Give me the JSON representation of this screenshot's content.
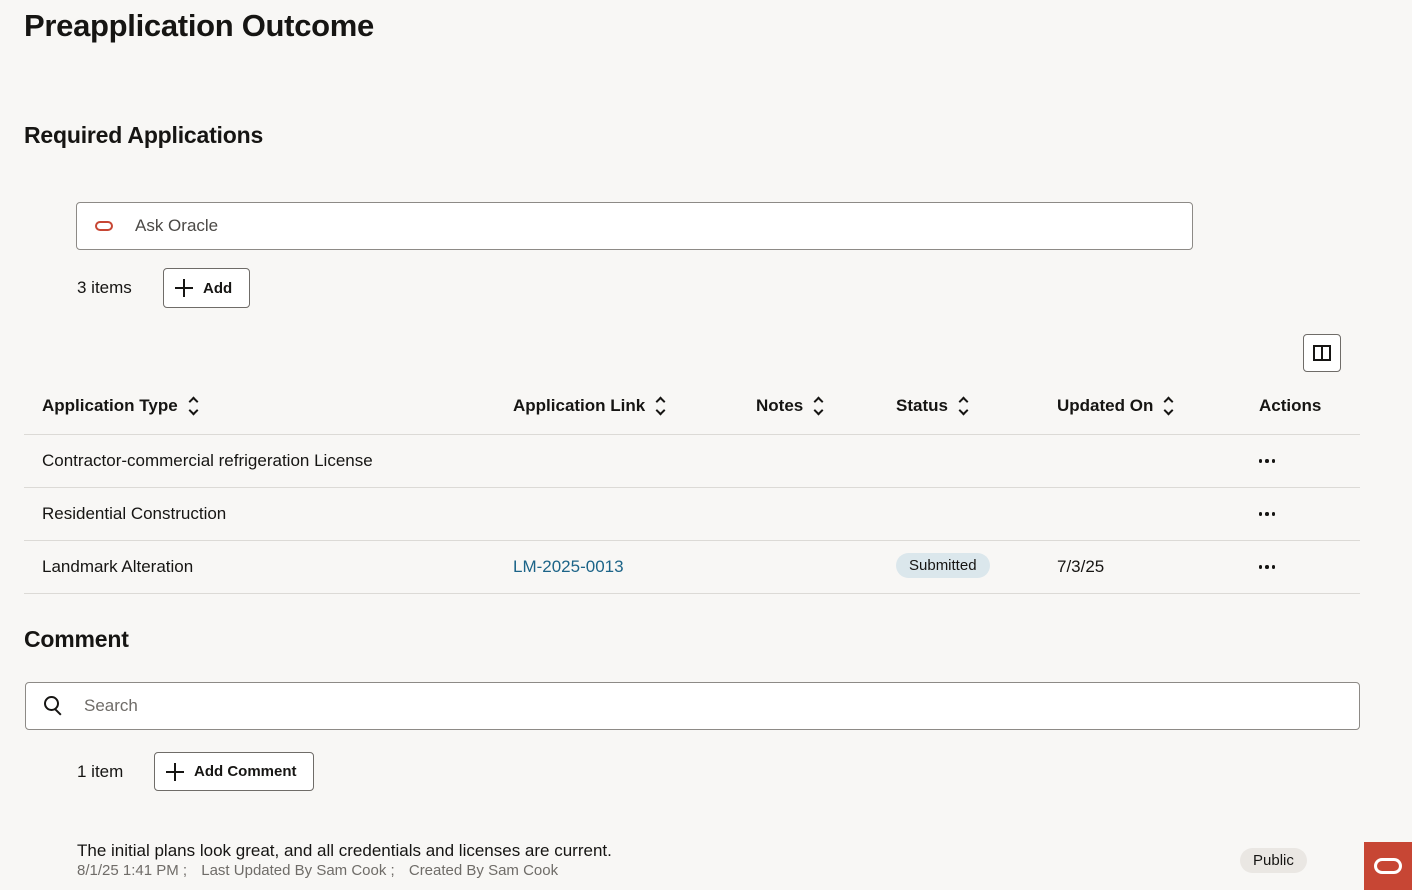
{
  "page": {
    "title": "Preapplication Outcome"
  },
  "required_applications": {
    "title": "Required Applications",
    "ask_oracle": {
      "placeholder": "Ask Oracle"
    },
    "count": "3 items",
    "add_label": "Add",
    "columns": [
      "Application Type",
      "Application Link",
      "Notes",
      "Status",
      "Updated On",
      "Actions"
    ],
    "rows": [
      {
        "type": "Contractor-commercial refrigeration License",
        "link": "",
        "notes": "",
        "status": "",
        "updated": ""
      },
      {
        "type": "Residential Construction",
        "link": "",
        "notes": "",
        "status": "",
        "updated": ""
      },
      {
        "type": "Landmark Alteration",
        "link": "LM-2025-0013",
        "notes": "",
        "status": "Submitted",
        "updated": "7/3/25"
      }
    ]
  },
  "comment": {
    "title": "Comment",
    "search": {
      "placeholder": "Search"
    },
    "count": "1 item",
    "add_label": "Add Comment",
    "items": [
      {
        "text": "The initial plans look great, and all credentials and licenses are current.",
        "timestamp": "8/1/25 1:41 PM ;",
        "last_updated": "Last Updated By Sam Cook ;",
        "created": "Created By Sam Cook",
        "visibility": "Public"
      }
    ]
  },
  "colors": {
    "oracle_red": "#c74634",
    "link": "#1c6488",
    "status_badge": "#dbe7ec",
    "background": "#f8f7f5"
  }
}
